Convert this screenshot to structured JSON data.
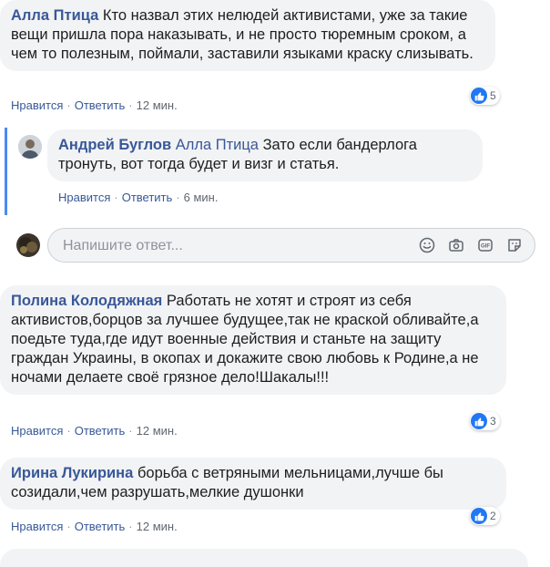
{
  "comments": [
    {
      "author": "Алла Птица",
      "text": "Кто назвал этих нелюдей активистами, уже за такие вещи пришла пора наказывать, и не просто тюремным сроком, а чем то полезным, поймали, заставили языками краску слизывать.",
      "like_label": "Нравится",
      "reply_label": "Ответить",
      "time": "12 мин.",
      "reactions": "5"
    },
    {
      "author": "Полина Колодяжная",
      "text": "Работать не хотят и строят из себя активистов,борцов за лучшее будущее,так не краской обливайте,а поедьте туда,где идут военные действия и станьте на защиту граждан Украины, в окопах и докажите свою любовь к Родине,а не ночами делаете своё грязное дело!Шакалы!!!",
      "like_label": "Нравится",
      "reply_label": "Ответить",
      "time": "12 мин.",
      "reactions": "3"
    },
    {
      "author": "Ирина Лукирина",
      "text": "борьба с ветряными мельницами,лучше бы созидали,чем разрушать,мелкие душонки",
      "like_label": "Нравится",
      "reply_label": "Ответить",
      "time": "12 мин.",
      "reactions": "2"
    }
  ],
  "reply": {
    "author": "Андрей Буглов",
    "mention": "Алла Птица",
    "text": "Зато если бандерлога тронуть, вот тогда будет и визг и статья.",
    "like_label": "Нравится",
    "reply_label": "Ответить",
    "time": "6 мин."
  },
  "reply_box": {
    "placeholder": "Напишите ответ..."
  },
  "icons": {
    "emoji": "emoji-icon",
    "camera": "camera-icon",
    "gif": "gif-icon",
    "sticker": "sticker-icon",
    "like": "like-icon"
  },
  "colors": {
    "name_link": "#385898",
    "bubble_bg": "#f2f3f5",
    "like_blue": "#2078f4",
    "thread_line": "#4a8af4"
  }
}
